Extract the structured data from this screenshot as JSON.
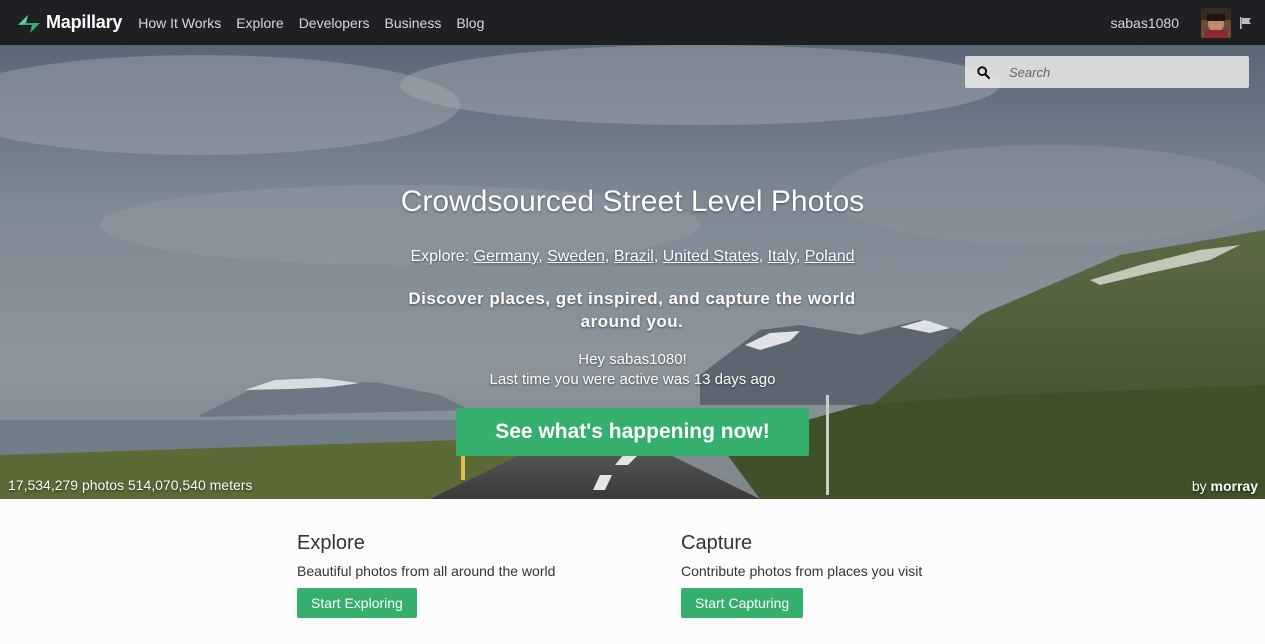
{
  "brand": {
    "name": "Mapillary",
    "color": "#35af6d"
  },
  "nav": {
    "links": [
      "How It Works",
      "Explore",
      "Developers",
      "Business",
      "Blog"
    ],
    "username": "sabas1080"
  },
  "search": {
    "placeholder": "Search"
  },
  "hero": {
    "title": "Crowdsourced Street Level Photos",
    "explore_prefix": "Explore:",
    "explore_places": [
      "Germany",
      "Sweden",
      "Brazil",
      "United States",
      "Italy",
      "Poland"
    ],
    "tagline": "Discover places, get inspired, and capture the world around you.",
    "greeting": "Hey sabas1080!",
    "last_active": "Last time you were active was 13 days ago",
    "cta": "See what's happening now!",
    "stats": "17,534,279 photos 514,070,540 meters",
    "credit_prefix": "by",
    "credit_author": "morray"
  },
  "sections": {
    "explore": {
      "title": "Explore",
      "desc": "Beautiful photos from all around the world",
      "button": "Start Exploring"
    },
    "capture": {
      "title": "Capture",
      "desc": "Contribute photos from places you visit",
      "button": "Start Capturing"
    }
  }
}
